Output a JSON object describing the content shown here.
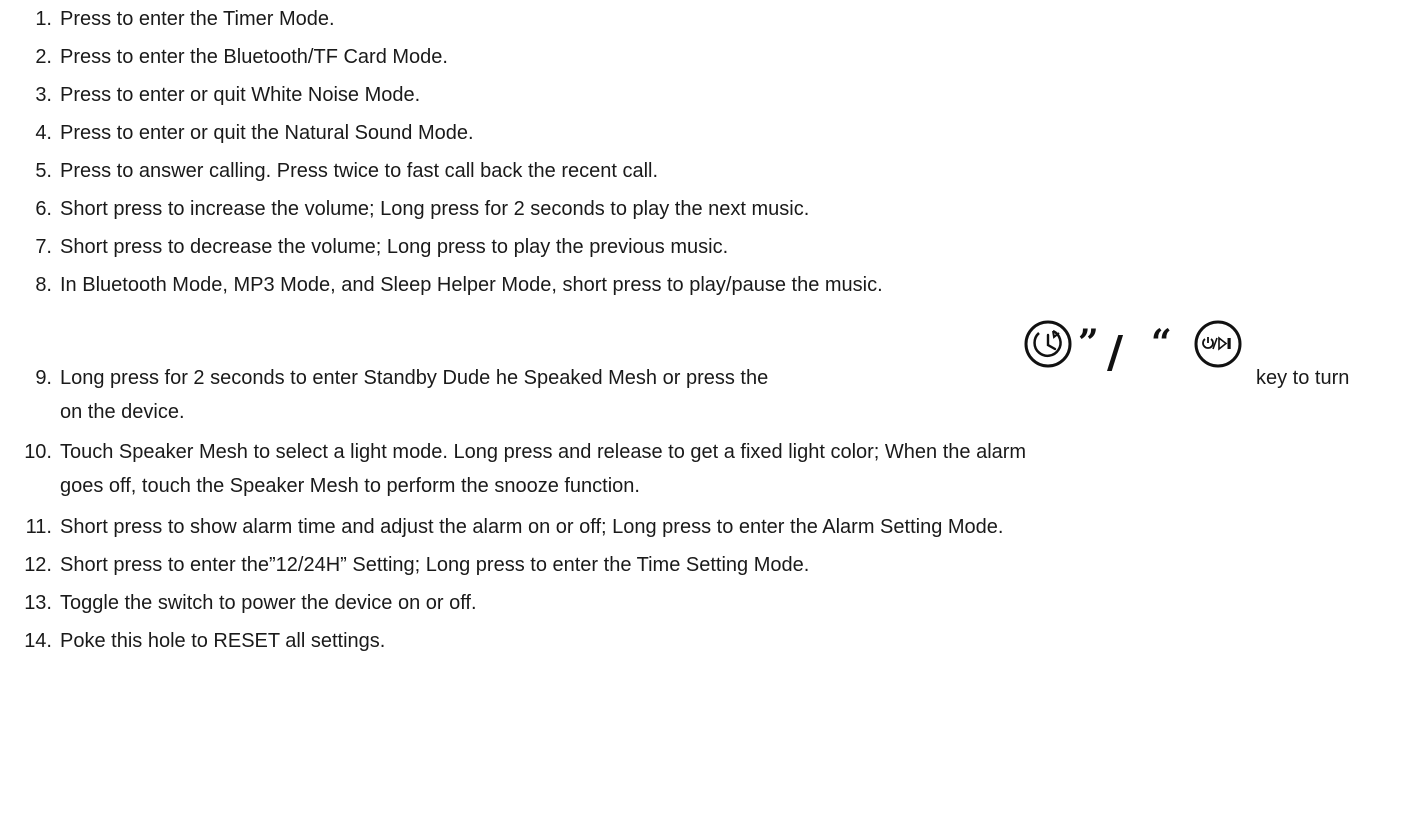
{
  "document": {
    "items": [
      {
        "num": "1.",
        "text": "Press to enter the Timer Mode."
      },
      {
        "num": "2.",
        "text": "Press to enter the Bluetooth/TF Card Mode."
      },
      {
        "num": "3.",
        "text": "Press to enter or quit White Noise Mode."
      },
      {
        "num": "4.",
        "text": "Press to enter or quit the Natural Sound Mode."
      },
      {
        "num": "5.",
        "text": "Press to answer calling. Press twice to fast call back the recent call."
      },
      {
        "num": "6.",
        "text": "Short press to increase the volume; Long press for 2 seconds to play the next music."
      },
      {
        "num": "7.",
        "text": "Short press to decrease the volume; Long press to play the previous music."
      },
      {
        "num": "8.",
        "text": "In Bluetooth Mode, MP3 Mode, and Sleep Helper Mode, short press to play/pause the music."
      },
      {
        "num": "9.",
        "text_before": "Long press for 2 seconds to enter Standby Dude he Speaked Mesh or press the",
        "glyph_close": "”",
        "glyph_slash": "/",
        "glyph_open": "“",
        "text_after": "key to turn",
        "line2": "on the device."
      },
      {
        "num": "10.",
        "text": "Touch Speaker Mesh to select a light mode. Long press and release to get a fixed light color; When the alarm",
        "line2": "goes off, touch the Speaker Mesh to perform the snooze function."
      },
      {
        "num": "11.",
        "text": "Short press to show alarm time and adjust the alarm on or off; Long press to enter the Alarm Setting Mode."
      },
      {
        "num": "12.",
        "text": "Short press to enter the”12/24H” Setting; Long press to enter the Time Setting Mode."
      },
      {
        "num": "13.",
        "text": "Toggle the switch to power the device on or off."
      },
      {
        "num": "14.",
        "text": "Poke this hole to RESET all settings."
      }
    ],
    "icons": {
      "timer_key": "timer-key-icon",
      "power_play_key": "power-play-key-icon",
      "power_play_label": "⏻/▷❙"
    },
    "colors": {
      "text": "#1a1a1a",
      "icon": "#111111"
    }
  }
}
